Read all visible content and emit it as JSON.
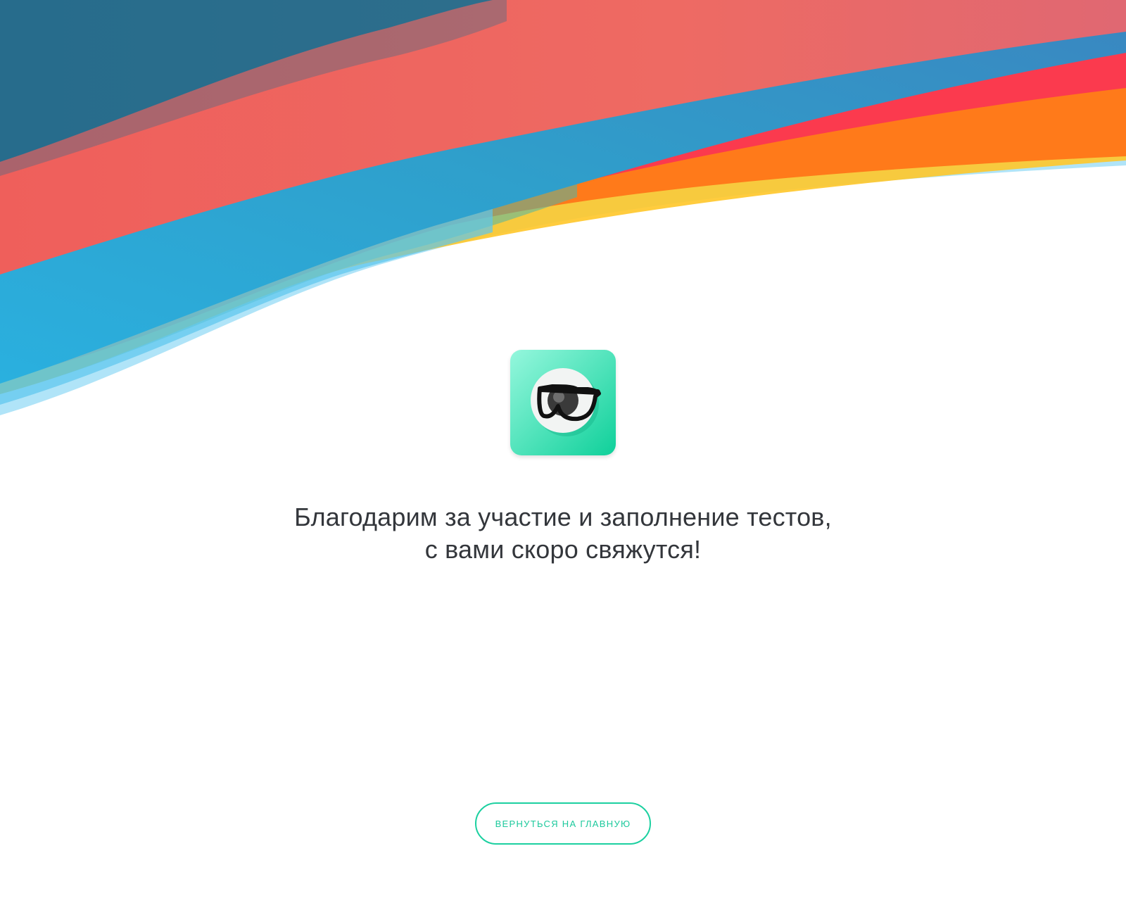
{
  "colors": {
    "accent": "#1cd0a0",
    "text": "#33363b",
    "wave_dark_blue": "#2a6a8a",
    "wave_coral": "#f0645e",
    "wave_blue": "#2f9fcb",
    "wave_red": "#fb3a4e",
    "wave_orange": "#ff7a1a",
    "wave_yellow": "#ffc629",
    "wave_light_blue": "#57c3ef",
    "logo_gradient_start": "#8ef5dc",
    "logo_gradient_end": "#10d29a"
  },
  "logo": {
    "icon": "eye-glasses-icon"
  },
  "message": {
    "line1": "Благодарим за участие и заполнение тестов,",
    "line2": "с вами скоро свяжутся!"
  },
  "home_button": {
    "label": "Вернуться на главную"
  }
}
